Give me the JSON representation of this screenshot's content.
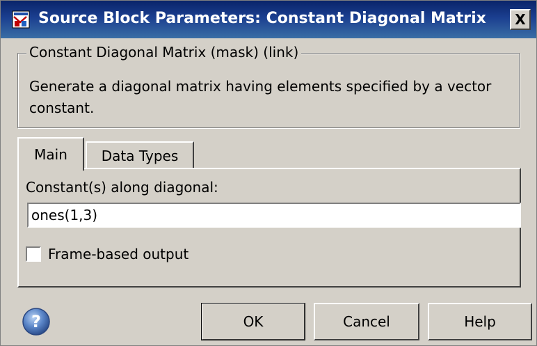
{
  "window": {
    "title": "Source Block Parameters: Constant Diagonal Matrix",
    "close_label": "X",
    "title_icon": "simulink-block-icon"
  },
  "group": {
    "legend": "Constant Diagonal Matrix (mask) (link)",
    "description": "Generate a diagonal matrix having elements specified by a vector constant."
  },
  "tabs": [
    {
      "label": "Main",
      "selected": true
    },
    {
      "label": "Data Types",
      "selected": false
    }
  ],
  "main_panel": {
    "constant_label": "Constant(s) along diagonal:",
    "constant_value": "ones(1,3)",
    "frame_based_label": "Frame-based output",
    "frame_based_checked": false
  },
  "buttons": {
    "help_icon": "question-icon",
    "ok": "OK",
    "cancel": "Cancel",
    "help": "Help"
  }
}
